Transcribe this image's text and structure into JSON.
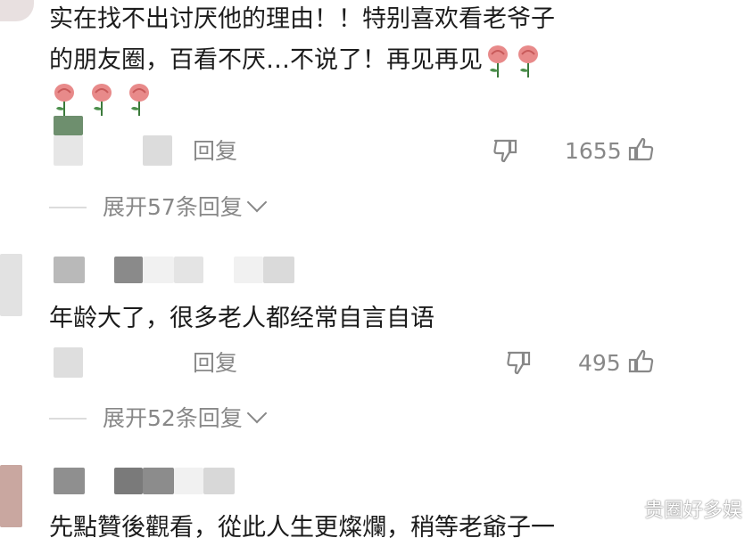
{
  "comments": [
    {
      "text_line1": "实在找不出讨厌他的理由！！特别喜欢看老爷子",
      "text_line2": "的朋友圈，百看不厌…不说了！再见再见",
      "reply_label": "回复",
      "like_count": "1655",
      "expand_label": "展开57条回复"
    },
    {
      "text_line1": "年龄大了，很多老人都经常自言自语",
      "reply_label": "回复",
      "like_count": "495",
      "expand_label": "展开52条回复"
    },
    {
      "text_line1": "先點贊後觀看，從此人生更燦爛，稍等老爺子一"
    }
  ],
  "icons": {
    "rose": "rose-emoji-icon",
    "dislike": "thumb-down-icon",
    "like": "thumb-up-icon",
    "expand": "chevron-down-icon"
  },
  "watermark": "贵圈好多娱"
}
